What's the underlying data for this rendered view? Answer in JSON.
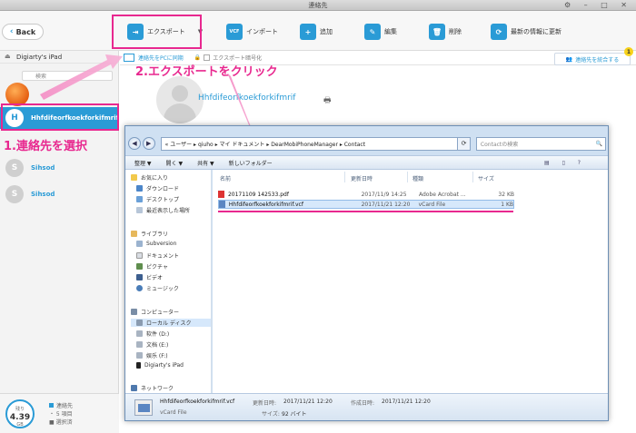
{
  "window": {
    "title": "連絡先"
  },
  "toolbar": {
    "back_label": "Back",
    "export_label": "エクスポート",
    "import_label": "インポート",
    "add_label": "追加",
    "edit_label": "編集",
    "delete_label": "削除",
    "refresh_label": "最新の情報に更新"
  },
  "sidebar": {
    "device_name": "Digiarty's iPad",
    "search_placeholder": "検索",
    "contacts": [
      {
        "initial": "H",
        "name": "Hhfdifeorfkoekforkifmrif"
      },
      {
        "initial": "S",
        "name": "Sihsod"
      },
      {
        "initial": "S",
        "name": "Sihsod"
      }
    ],
    "storage_label": "残り",
    "storage_value": "4.39",
    "storage_unit": "GB",
    "legend_contacts": "連絡先",
    "legend_items": "・ 5 項目",
    "legend_selected": "■ 選択済"
  },
  "main": {
    "sync_label": "連絡先をPCに同期",
    "encrypt_label": "エクスポート暗号化",
    "merge_label": "連絡先を統合する",
    "merge_badge": "1",
    "contact_name": "Hhfdifeorfkoekforkifmrif"
  },
  "annotations": {
    "step1": "1.連絡先を選択",
    "step2": "2.エクスポートをクリック"
  },
  "explorer": {
    "address_path": "« ユーザー ▸ qiuho ▸ マイ ドキュメント ▸ DearMobiPhoneManager ▸ Contact",
    "search_placeholder": "Contactの検索",
    "cmd_organize": "整理 ▼",
    "cmd_open": "開く ▼",
    "cmd_share": "共有 ▼",
    "cmd_newfolder": "新しいフォルダー",
    "columns": {
      "name": "名前",
      "date": "更新日時",
      "type": "種類",
      "size": "サイズ"
    },
    "nav": {
      "favorites": "お気に入り",
      "downloads": "ダウンロード",
      "desktop": "デスクトップ",
      "recent": "最近表示した場所",
      "libraries": "ライブラリ",
      "subversion": "Subversion",
      "documents": "ドキュメント",
      "pictures": "ピクチャ",
      "videos": "ビデオ",
      "music": "ミュージック",
      "computer": "コンピューター",
      "local_disk": "ローカル ディスク",
      "drive_d": "软件 (D:)",
      "drive_e": "文档 (E:)",
      "drive_f": "娱乐 (F:)",
      "ipad": "Digiarty's iPad",
      "network": "ネットワーク"
    },
    "files": [
      {
        "name": "20171109 142533.pdf",
        "date": "2017/11/9 14:25",
        "type": "Adobe Acrobat ...",
        "size": "32 KB",
        "kind": "pdf"
      },
      {
        "name": "Hhfdifeorfkoekforkifmrif.vcf",
        "date": "2017/11/21 12:20",
        "type": "vCard File",
        "size": "1 KB",
        "kind": "vcf"
      }
    ],
    "details": {
      "filename": "Hhfdifeorfkoekforkifmrif.vcf",
      "modified_label": "更新日時:",
      "modified_value": "2017/11/21 12:20",
      "created_label": "作成日時:",
      "created_value": "2017/11/21 12:20",
      "type": "vCard File",
      "size_label": "サイズ:",
      "size_value": "92 バイト"
    }
  },
  "colors": {
    "accent": "#2a9bd6",
    "highlight": "#e8288f"
  }
}
